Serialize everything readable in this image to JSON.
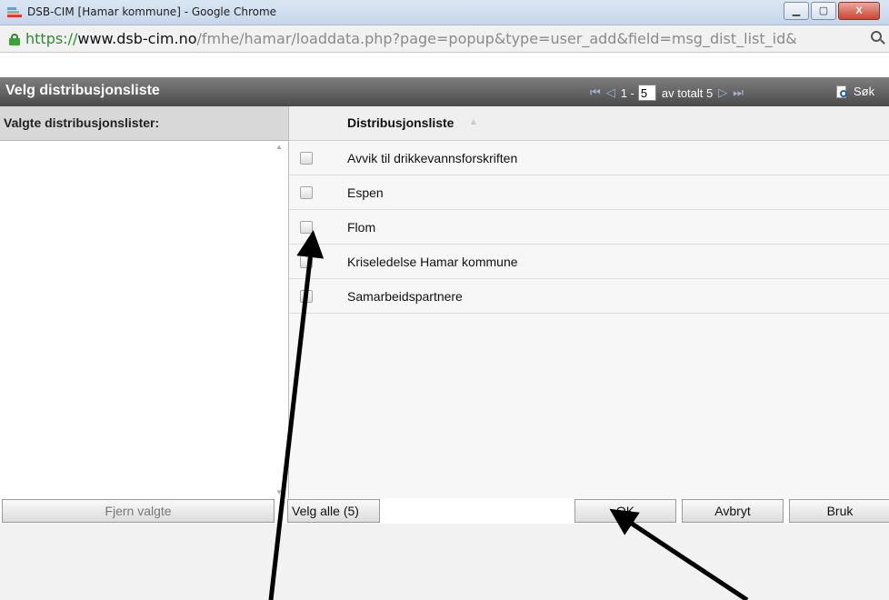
{
  "window": {
    "title": "DSB-CIM [Hamar kommune] - Google Chrome",
    "minimize_label": "▁",
    "maximize_label": "▢",
    "close_label": "X"
  },
  "address": {
    "scheme": "https://",
    "host": "www.dsb-cim.no",
    "path": "/fmhe/hamar/loaddata.php?page=popup&type=user_add&field=msg_dist_list_id&"
  },
  "dialog": {
    "title": "Velg distribusjonsliste",
    "pager": {
      "range_prefix": "1 -",
      "page_value": "5",
      "total_text": "av totalt 5"
    },
    "search_label": "Søk"
  },
  "left_panel": {
    "header": "Valgte distribusjonslister:",
    "remove_button": "Fjern valgte"
  },
  "grid": {
    "column_header": "Distribusjonsliste",
    "rows": [
      {
        "label": "Avvik til drikkevannsforskriften",
        "checked": false
      },
      {
        "label": "Espen",
        "checked": false
      },
      {
        "label": "Flom",
        "checked": false
      },
      {
        "label": "Kriseledelse Hamar kommune",
        "checked": false
      },
      {
        "label": "Samarbeidspartnere",
        "checked": false
      }
    ],
    "select_all_button": "Velg alle (5)"
  },
  "actions": {
    "ok": "OK",
    "cancel": "Avbryt",
    "apply": "Bruk"
  },
  "colors": {
    "header_bg": "#4a4a4a",
    "secure_green": "#2e8b2e",
    "annotation": "#000000"
  }
}
